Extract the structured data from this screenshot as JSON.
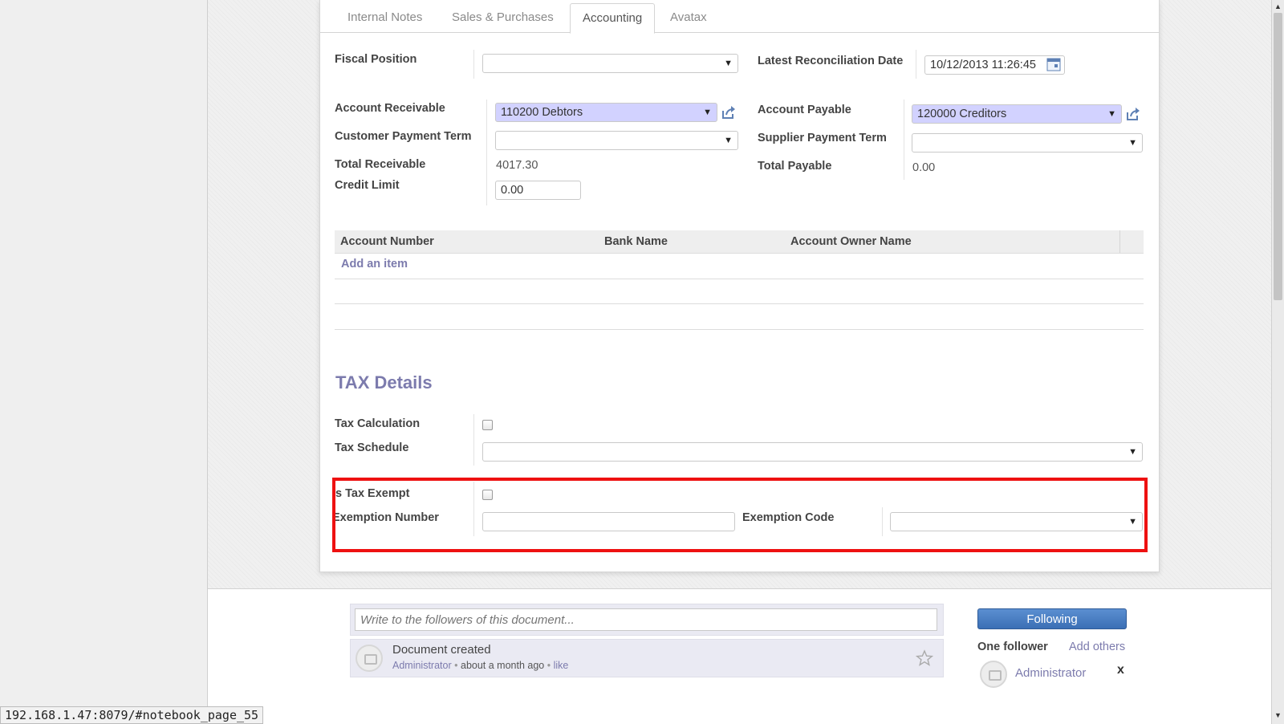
{
  "tabs": [
    {
      "label": "Internal Notes"
    },
    {
      "label": "Sales & Purchases"
    },
    {
      "label": "Accounting"
    },
    {
      "label": "Avatax"
    }
  ],
  "form": {
    "fiscal_position": {
      "label": "Fiscal Position",
      "value": ""
    },
    "latest_reconciliation_date": {
      "label": "Latest Reconciliation Date",
      "value": "10/12/2013 11:26:45"
    },
    "account_receivable": {
      "label": "Account Receivable",
      "value": "110200 Debtors"
    },
    "account_payable": {
      "label": "Account Payable",
      "value": "120000 Creditors"
    },
    "customer_payment_term": {
      "label": "Customer Payment Term",
      "value": ""
    },
    "supplier_payment_term": {
      "label": "Supplier Payment Term",
      "value": ""
    },
    "total_receivable": {
      "label": "Total Receivable",
      "value": "4017.30"
    },
    "total_payable": {
      "label": "Total Payable",
      "value": "0.00"
    },
    "credit_limit": {
      "label": "Credit Limit",
      "value": "0.00"
    }
  },
  "bank_grid": {
    "columns": [
      "Account Number",
      "Bank Name",
      "Account Owner Name"
    ],
    "add_item": "Add an item"
  },
  "tax": {
    "title": "TAX Details",
    "tax_calculation": {
      "label": "Tax Calculation",
      "checked": false
    },
    "tax_schedule": {
      "label": "Tax Schedule",
      "value": ""
    },
    "is_tax_exempt": {
      "label": "Is Tax Exempt",
      "checked": false
    },
    "exemption_number": {
      "label": "Exemption Number",
      "value": ""
    },
    "exemption_code": {
      "label": "Exemption Code",
      "value": ""
    }
  },
  "chatter": {
    "compose_placeholder": "Write to the followers of this document...",
    "message": {
      "title": "Document created",
      "author": "Administrator",
      "separator": "•",
      "time": "about a month ago",
      "like": "like"
    },
    "following_button": "Following",
    "follower_count": "One follower",
    "add_others": "Add others",
    "follower_name": "Administrator",
    "remove": "x"
  },
  "status_bar": "192.168.1.47:8079/#notebook_page_55",
  "colors": {
    "accent": "#7c7bad",
    "required_field": "#d2d2ff",
    "highlight": "#ee1111",
    "button": "#3b6fb5"
  }
}
